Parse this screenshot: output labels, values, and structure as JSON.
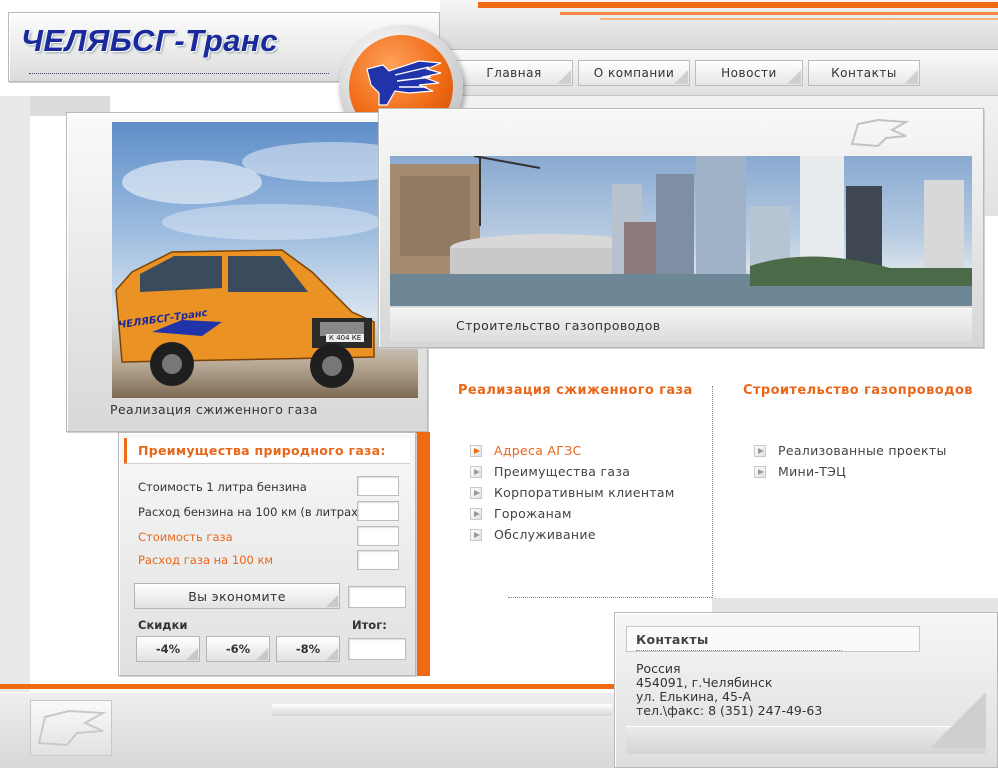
{
  "header": {
    "logo_text": "ЧЕЛЯБСГ-Транс",
    "nav": [
      "Главная",
      "О компании",
      "Новости",
      "Контакты"
    ]
  },
  "banners": {
    "left_caption": "Реализация сжиженного газа",
    "right_caption": "Строительство газопроводов",
    "van_text": "ЧЕЛЯБСГ-Транс",
    "plate_text": "К 404 КЕ"
  },
  "calculator": {
    "title": "Преимущества природного газа:",
    "row1": "Стоимость 1 литра бензина",
    "row2": "Расход бензина на 100 км (в литрах)",
    "row3": "Стоимость газа",
    "row4": "Расход газа на 100 км",
    "save_button": "Вы экономите",
    "discounts_label": "Скидки",
    "total_label": "Итог:",
    "discounts": [
      "-4%",
      "-6%",
      "-8%"
    ]
  },
  "section_lpg": {
    "title": "Реализация сжиженного газа",
    "items": [
      "Адреса АГЗС",
      "Преимущества газа",
      "Корпоративным клиентам",
      "Горожанам",
      "Обслуживание"
    ]
  },
  "section_pipes": {
    "title": "Строительство газопроводов",
    "items": [
      "Реализованные проекты",
      "Мини-ТЭЦ"
    ]
  },
  "contacts": {
    "title": "Контакты",
    "country": "Россия",
    "city": "454091, г.Челябинск",
    "street": "ул. Елькина, 45-А",
    "phone": "тел.\\факс: 8 (351) 247-49-63"
  },
  "colors": {
    "accent": "#f06a14",
    "logo_blue": "#1a2a9c"
  }
}
